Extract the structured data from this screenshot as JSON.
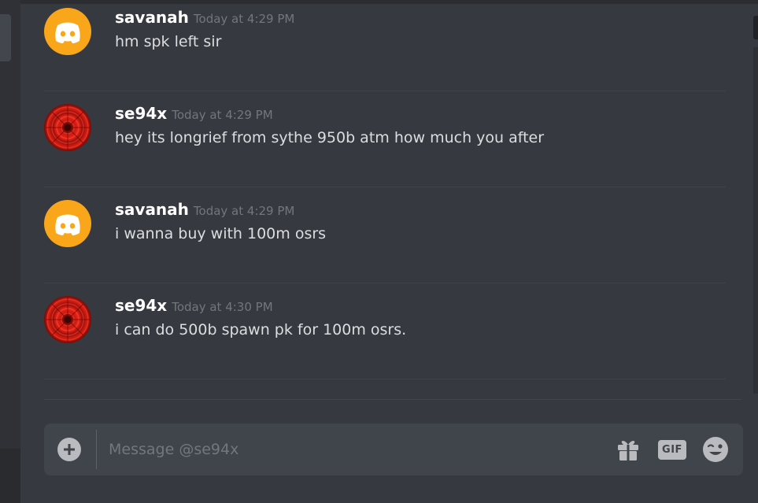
{
  "messages": [
    {
      "username": "savanah",
      "timestamp": "Today at 4:29 PM",
      "text": "hm spk left sir",
      "avatar": "discord-logo-icon"
    },
    {
      "username": "se94x",
      "timestamp": "Today at 4:29 PM",
      "text": "hey its longrief from sythe 950b atm how much you after",
      "avatar": "flower-photo"
    },
    {
      "username": "savanah",
      "timestamp": "Today at 4:29 PM",
      "text": "i wanna buy with 100m osrs",
      "avatar": "discord-logo-icon"
    },
    {
      "username": "se94x",
      "timestamp": "Today at 4:30 PM",
      "text": "i can do 500b spawn pk for 100m osrs.",
      "avatar": "flower-photo"
    }
  ],
  "composer": {
    "placeholder": "Message @se94x",
    "value": "",
    "gif_label": "GIF"
  },
  "colors": {
    "background": "#36393f",
    "composer_bg": "#40444b",
    "discord_avatar": "#faa61a"
  }
}
